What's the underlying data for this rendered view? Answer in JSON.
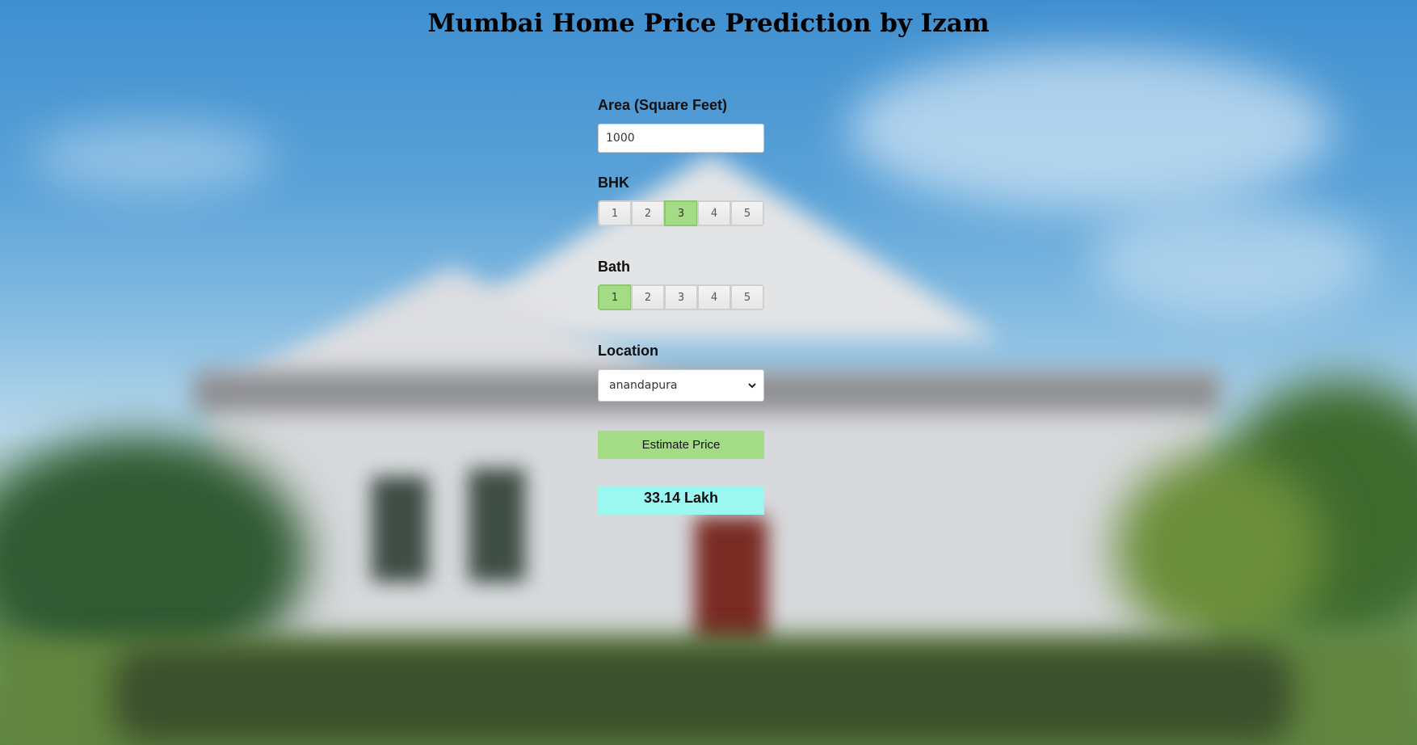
{
  "page": {
    "title": "Mumbai Home Price Prediction by Izam"
  },
  "form": {
    "area": {
      "label": "Area (Square Feet)",
      "value": "1000"
    },
    "bhk": {
      "label": "BHK",
      "options": [
        "1",
        "2",
        "3",
        "4",
        "5"
      ],
      "selected": "3"
    },
    "bath": {
      "label": "Bath",
      "options": [
        "1",
        "2",
        "3",
        "4",
        "5"
      ],
      "selected": "1"
    },
    "location": {
      "label": "Location",
      "selected": "anandapura"
    },
    "estimate_button": "Estimate Price",
    "result": "33.14 Lakh"
  },
  "colors": {
    "accent_green": "#a3dc84",
    "result_bg": "#9cf7f1"
  },
  "icons": {
    "dropdown": "chevron-down-icon"
  }
}
